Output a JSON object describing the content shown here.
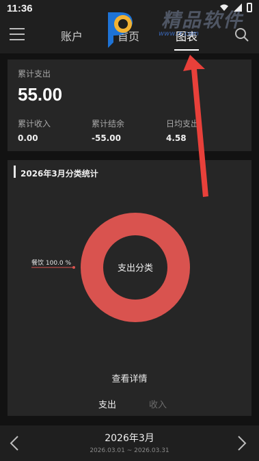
{
  "status_bar": {
    "time": "11:36"
  },
  "nav": {
    "tabs": [
      {
        "label": "账户",
        "active": false
      },
      {
        "label": "首页",
        "active": false
      },
      {
        "label": "图表",
        "active": true
      }
    ]
  },
  "summary": {
    "main_label": "累计支出",
    "main_value": "55.00",
    "items": [
      {
        "label": "累计收入",
        "value": "0.00"
      },
      {
        "label": "累计结余",
        "value": "-55.00"
      },
      {
        "label": "日均支出",
        "value": "4.58"
      }
    ]
  },
  "stats": {
    "title": "2026年3月分类统计",
    "center_label": "支出分类",
    "details_link": "查看详情",
    "toggle": [
      {
        "label": "支出",
        "active": true
      },
      {
        "label": "收入",
        "active": false
      }
    ]
  },
  "chart_data": {
    "type": "pie",
    "categories": [
      "餐饮"
    ],
    "values": [
      100.0
    ],
    "labels": [
      "餐饮 100.0 %"
    ],
    "colors": [
      "#d9534f"
    ]
  },
  "month_bar": {
    "title": "2026年3月",
    "range": "2026.03.01 ~ 2026.03.31"
  },
  "watermark": {
    "url": "www.rr.com"
  },
  "colors": {
    "background": "#121212",
    "card": "#262626",
    "bar": "#1f1f1f",
    "accent_red": "#d9534f",
    "annotation_red": "#e8403a"
  }
}
